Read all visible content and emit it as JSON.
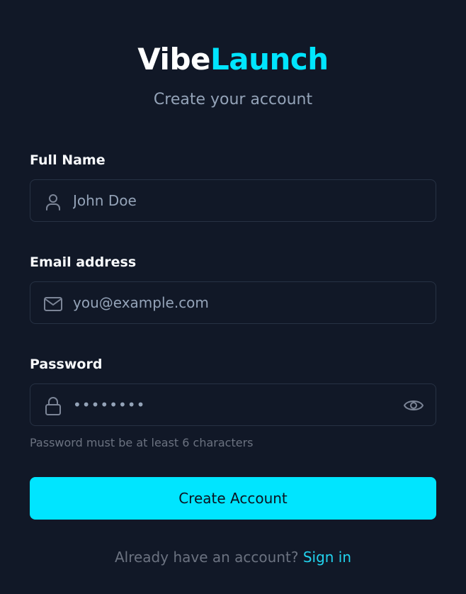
{
  "brand": {
    "part1": "Vibe",
    "part2": "Launch",
    "color_primary": "#ffffff",
    "color_accent": "#00e5ff"
  },
  "subtitle": "Create your account",
  "form": {
    "full_name": {
      "label": "Full Name",
      "placeholder": "John Doe",
      "icon": "user-icon"
    },
    "email": {
      "label": "Email address",
      "placeholder": "you@example.com",
      "icon": "mail-icon"
    },
    "password": {
      "label": "Password",
      "value": "••••••••",
      "icon": "lock-icon",
      "toggle_icon": "eye-icon",
      "hint": "Password must be at least 6 characters"
    },
    "submit_label": "Create Account"
  },
  "footer": {
    "prompt": "Already have an account?",
    "link_label": "Sign in"
  },
  "colors": {
    "background": "#111827",
    "field_border": "#273244",
    "button": "#00e5ff",
    "link": "#22d3ee",
    "muted_text": "#6b7280"
  }
}
